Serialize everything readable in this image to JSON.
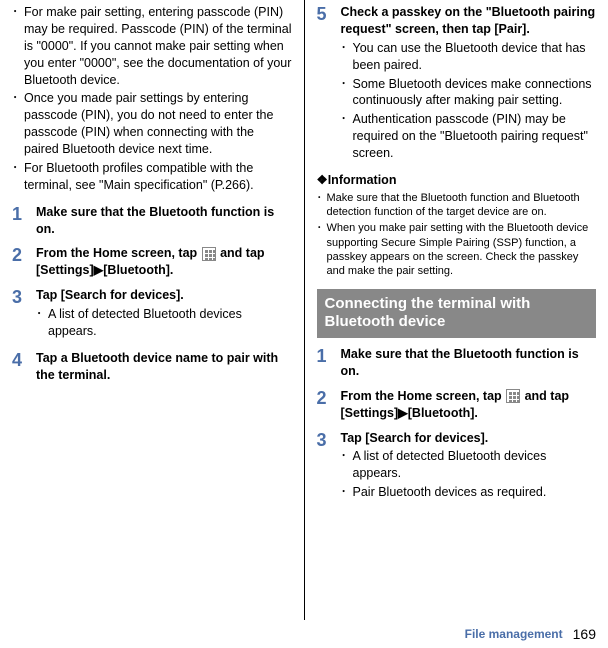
{
  "left": {
    "bullets": [
      "For make pair setting, entering passcode (PIN) may be required. Passcode (PIN) of the terminal is \"0000\". If you cannot make pair setting when you enter \"0000\", see the documentation of your Bluetooth device.",
      "Once you made pair settings by entering passcode (PIN), you do not need to enter the passcode (PIN) when connecting with the paired Bluetooth device next time.",
      "For Bluetooth profiles compatible with the terminal, see \"Main specification\" (P.266)."
    ],
    "steps": [
      {
        "num": "1",
        "head": "Make sure that the Bluetooth function is on."
      },
      {
        "num": "2",
        "head_pre": "From the Home screen, tap ",
        "head_post": " and tap [Settings]",
        "head_tri": "▶",
        "head_end": "[Bluetooth].",
        "has_icon": true
      },
      {
        "num": "3",
        "head": "Tap [Search for devices].",
        "subs": [
          "A list of detected Bluetooth devices appears."
        ]
      },
      {
        "num": "4",
        "head": "Tap a Bluetooth device name to pair with the terminal."
      }
    ]
  },
  "right": {
    "top_step": {
      "num": "5",
      "head": "Check a passkey on the \"Bluetooth pairing request\" screen, then tap [Pair].",
      "subs": [
        "You can use the Bluetooth device that has been paired.",
        "Some Bluetooth devices make connections continuously after making pair setting.",
        "Authentication passcode (PIN) may be required on the \"Bluetooth pairing request\" screen."
      ]
    },
    "info_head": "❖Information",
    "info": [
      "Make sure that the Bluetooth function and Bluetooth detection function of the target device are on.",
      "When you make pair setting with the Bluetooth device supporting Secure Simple Pairing (SSP) function, a passkey appears on the screen. Check the passkey and make the pair setting."
    ],
    "section_title": "Connecting the terminal with Bluetooth device",
    "steps2": [
      {
        "num": "1",
        "head": "Make sure that the Bluetooth function is on."
      },
      {
        "num": "2",
        "head_pre": "From the Home screen, tap ",
        "head_post": " and tap [Settings]",
        "head_tri": "▶",
        "head_end": "[Bluetooth].",
        "has_icon": true
      },
      {
        "num": "3",
        "head": "Tap [Search for devices].",
        "subs": [
          "A list of detected Bluetooth devices appears.",
          "Pair Bluetooth devices as required."
        ]
      }
    ]
  },
  "footer": {
    "section": "File management",
    "page": "169"
  }
}
